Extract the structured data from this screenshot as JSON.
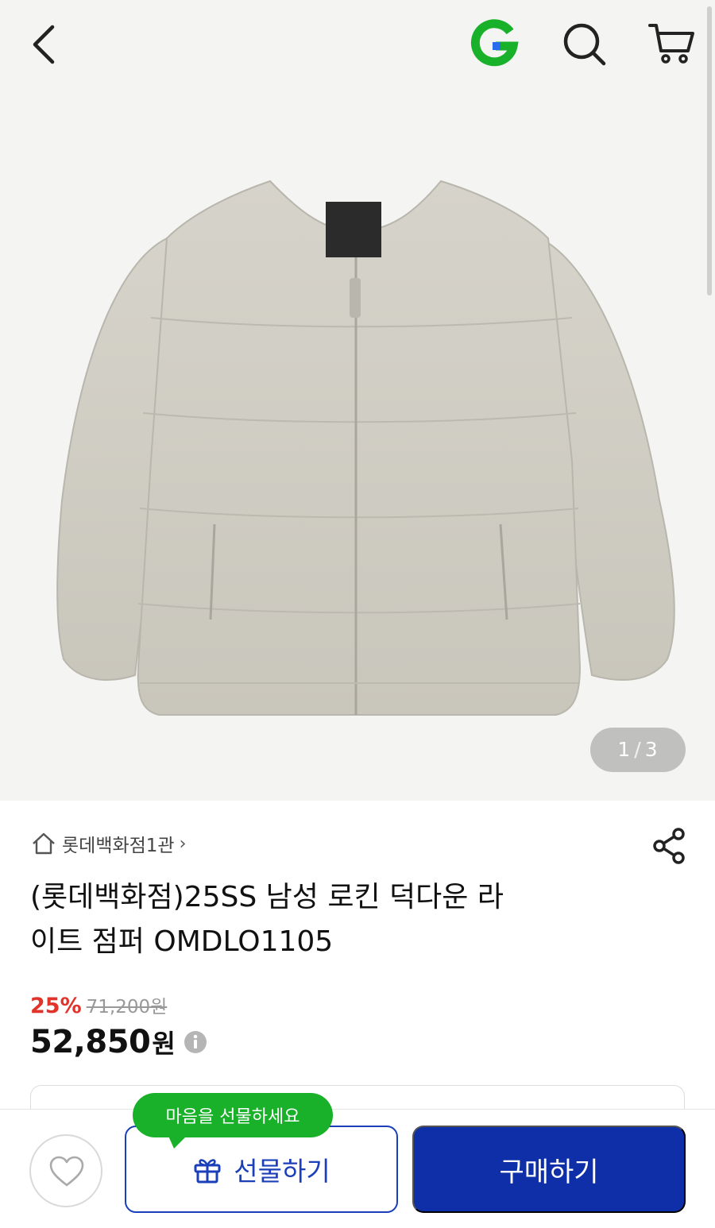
{
  "header": {
    "back_icon": "chevron-left-icon",
    "brand_icon": "gmarket-g-logo",
    "search_icon": "search-icon",
    "cart_icon": "cart-icon"
  },
  "gallery": {
    "image": "beige-padded-down-jacket",
    "pager": {
      "current": "1",
      "separator": "/",
      "total": "3"
    }
  },
  "store": {
    "name": "롯데백화점1관",
    "chevron": "›"
  },
  "product": {
    "title_line1": "(롯데백화점)25SS 남성 로킨 덕다운 라",
    "title_line2": "이트 점퍼 OMDLO1105"
  },
  "price": {
    "discount": "25%",
    "original": "71,200원",
    "sale": "52,850",
    "unit": "원"
  },
  "actions": {
    "tooltip": "마음을 선물하세요",
    "gift_label": "선물하기",
    "buy_label": "구매하기"
  },
  "colors": {
    "brand_green": "#19b12a",
    "primary_blue": "#0e2fa8",
    "discount_red": "#e0342b"
  }
}
